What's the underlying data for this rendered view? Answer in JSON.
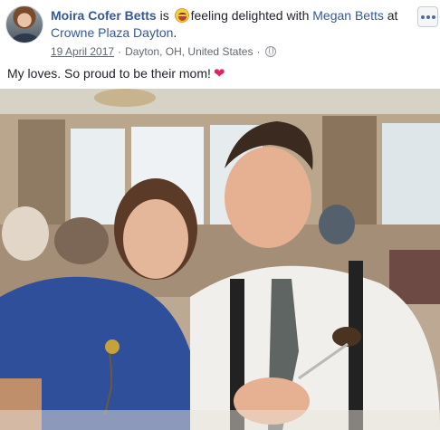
{
  "post": {
    "author": "Moira Cofer Betts",
    "is_text": "is",
    "activity": "feeling delighted with",
    "tagged_person": "Megan Betts",
    "at_text": "at",
    "place": "Crowne Plaza Dayton",
    "place_period": ".",
    "date": "19 April 2017",
    "location_sep": "·",
    "location": "Dayton, OH, United States",
    "privacy_sep": "·",
    "privacy_icon": "globe-icon",
    "message": "My loves. So proud to be their mom!",
    "message_emoji": "❤",
    "feeling_emoji": "grinning-face-icon",
    "more_icon": "more-options-icon",
    "accent_color": "#365899"
  }
}
